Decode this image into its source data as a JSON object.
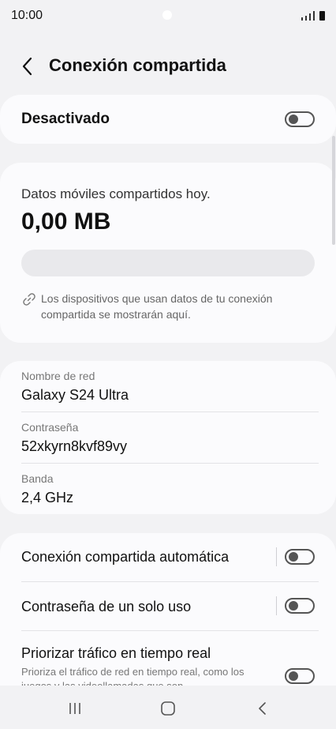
{
  "status_bar": {
    "time": "10:00"
  },
  "header": {
    "title": "Conexión compartida"
  },
  "master": {
    "label": "Desactivado"
  },
  "data_usage": {
    "caption": "Datos móviles compartidos hoy.",
    "value": "0,00 MB",
    "usage_fraction": 0,
    "info": "Los dispositivos que usan datos de tu conexión compartida se mostrarán aquí."
  },
  "network": {
    "name_label": "Nombre de red",
    "name_value": "Galaxy S24 Ultra",
    "password_label": "Contraseña",
    "password_value": "52xkyrn8kvf89vy",
    "band_label": "Banda",
    "band_value": "2,4 GHz"
  },
  "settings": {
    "auto_label": "Conexión compartida automática",
    "one_time_label": "Contraseña de un solo uso",
    "priority_label": "Priorizar tráfico en tiempo real",
    "priority_sub": "Prioriza el tráfico de red en tiempo real, como los juegos y las videollamadas que son"
  },
  "colors": {
    "background": "#f2f2f4",
    "card": "#fbfbfd",
    "toggle_off": "#555555"
  }
}
